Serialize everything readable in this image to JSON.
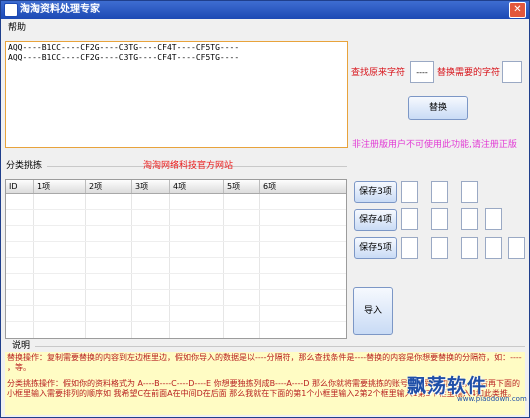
{
  "window": {
    "title": "淘淘资料处理专家"
  },
  "help": {
    "label": "帮助"
  },
  "textarea": {
    "content": "AQQ----B1CC----CF2G----C3TG----CF4T----CF5TG----\nAQQ----B1CC----CF2G----C3TG----CF4T----CF5TG----"
  },
  "replace": {
    "find_label": "查找原来字符",
    "find_value": "----",
    "replace_label": "替换需要的字符",
    "replace_value": "",
    "button_label": "替换",
    "warning": "非注册版用户不可使用此功能,请注册正版"
  },
  "sort": {
    "label": "分类挑拣",
    "website_link": "淘淘网络科技官方网站",
    "columns": [
      "ID",
      "1项",
      "2项",
      "3项",
      "4项",
      "5项",
      "6项"
    ],
    "save3_label": "保存3项",
    "save4_label": "保存4项",
    "save5_label": "保存5项",
    "import_label": "导入"
  },
  "notes": {
    "label": "说明",
    "para1": "替换操作：复制需要替换的内容到左边框里边，假如你导入的数据是以----分隔符，那么查找条件是----替换的内容是你想要替换的分隔符，如：---- ，等。",
    "para2": "分类挑拣操作：假如你的资料格式为 A----B----C----D----E 你想要独拣列成B----A----D 那么你就将需要挑拣的账号导入到右边框里，然后再下面的小框里输入需要排列的顺序如 我希望C在前面A在中间D在后面 那么我就在下面的第1个小框里输入2第2个框里输入1第3个框里输入4如此类推。"
  },
  "watermark": {
    "brand": "飘荡软件",
    "url": "www.piaodown.com"
  }
}
